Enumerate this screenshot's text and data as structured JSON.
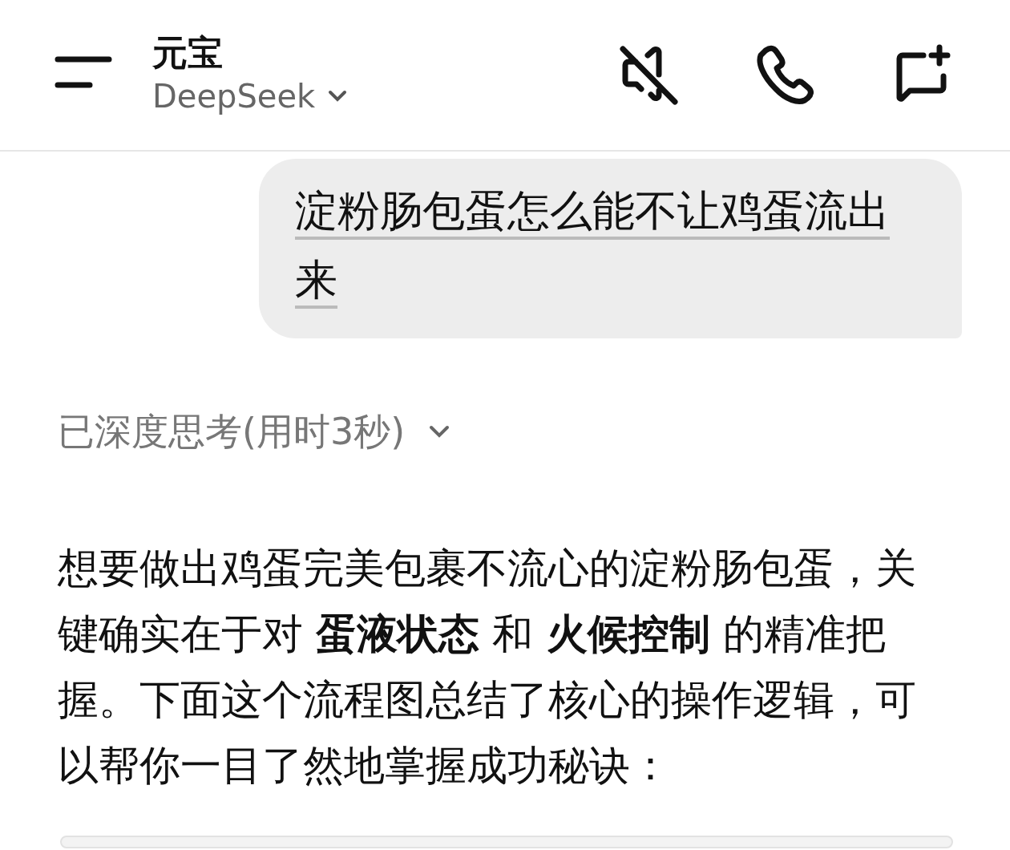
{
  "header": {
    "title": "元宝",
    "model": "DeepSeek"
  },
  "messages": [
    {
      "kind": "user",
      "text": "淀粉肠包蛋怎么能不让鸡蛋流出来"
    },
    {
      "kind": "thinking",
      "text": "已深度思考(用时3秒)"
    },
    {
      "kind": "answer",
      "text": "想要做出鸡蛋完美包裹不流心的淀粉肠包蛋，关键确实在于对 **蛋液状态** 和 **火候控制** 的精准把握。下面这个流程图总结了核心的操作逻辑，可以帮你一目了然地掌握成功秘诀："
    }
  ]
}
